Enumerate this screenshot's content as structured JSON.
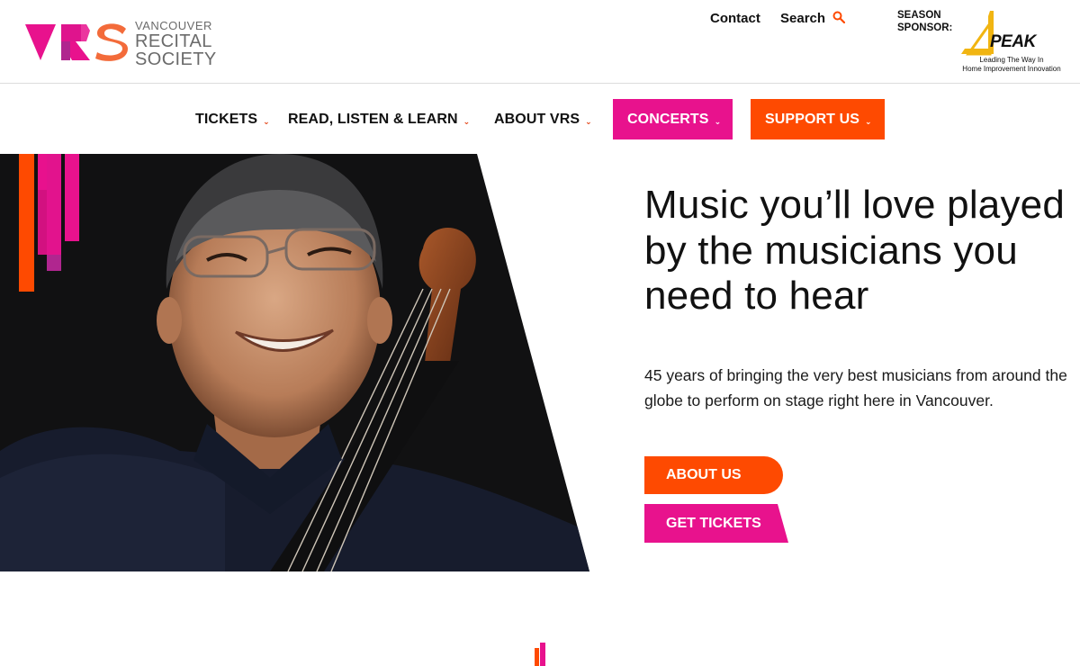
{
  "header": {
    "logo": {
      "mark": "VRS",
      "line1": "VANCOUVER",
      "line2": "RECITAL",
      "line3": "SOCIETY"
    },
    "utility": {
      "contact": "Contact",
      "search": "Search"
    },
    "sponsor": {
      "label_line1": "SEASON",
      "label_line2": "SPONSOR:",
      "name": "PEAK",
      "tagline_line1": "Leading The Way In",
      "tagline_line2": "Home Improvement Innovation"
    }
  },
  "nav": {
    "items": [
      {
        "label": "TICKETS",
        "chevron": "⌄"
      },
      {
        "label": "READ, LISTEN & LEARN",
        "chevron": "⌄"
      },
      {
        "label": "ABOUT VRS",
        "chevron": "⌄"
      },
      {
        "label": "CONCERTS",
        "chevron": "⌄"
      },
      {
        "label": "SUPPORT US",
        "chevron": "⌄"
      }
    ]
  },
  "hero": {
    "heading": "Music you’ll love played by the musicians you need to hear",
    "subtext": "45 years of bringing the very best musicians from around the globe to perform on stage right here in Vancouver.",
    "buttons": {
      "about": "ABOUT US",
      "tickets": "GET TICKETS"
    }
  },
  "colors": {
    "orange": "#fe4a01",
    "magenta": "#e8128d",
    "purple": "#b0268f",
    "logo_gray": "#6b6b6b"
  },
  "icons": {
    "search": "search-icon",
    "chevron": "chevron-down-icon"
  }
}
